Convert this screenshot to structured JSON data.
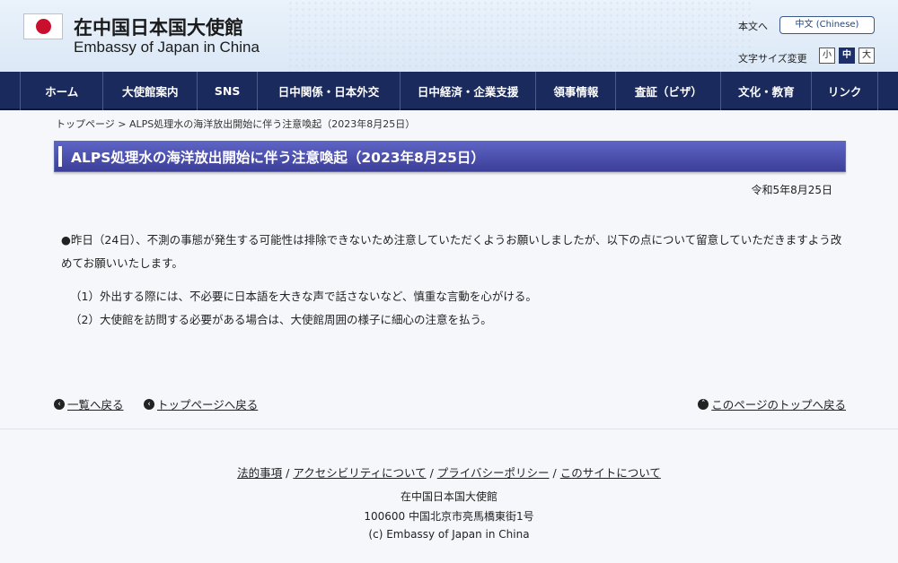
{
  "header": {
    "title_ja": "在中国日本国大使館",
    "title_en": "Embassy of Japan in China",
    "lang_ja": "本文へ",
    "lang_cn": "中文 (Chinese)",
    "size_label": "文字サイズ変更",
    "sizes": [
      "小",
      "中",
      "大"
    ],
    "size_selected": "中"
  },
  "nav": [
    "ホーム",
    "大使館案内",
    "SNS",
    "日中関係・日本外交",
    "日中経済・企業支援",
    "領事情報",
    "査証（ビザ）",
    "文化・教育",
    "リンク"
  ],
  "breadcrumb": {
    "home": "トップページ",
    "sep": " > ",
    "current": "ALPS処理水の海洋放出開始に伴う注意喚起（2023年8月25日）"
  },
  "page_title": "ALPS処理水の海洋放出開始に伴う注意喚起（2023年8月25日）",
  "date": "令和5年8月25日",
  "body": {
    "paragraph": "●昨日（24日）、不測の事態が発生する可能性は排除できないため注意していただくようお願いしましたが、以下の点について留意していただきますよう改めてお願いいたします。",
    "items": [
      "（1）外出する際には、不必要に日本語を大きな声で話さないなど、慎重な言動を心がける。",
      "（2）大使館を訪問する必要がある場合は、大使館周囲の様子に細心の注意を払う。"
    ]
  },
  "back_links": {
    "list": "一覧へ戻る",
    "top_page": "トップページへ戻る",
    "page_top": "このページのトップへ戻る"
  },
  "footer": {
    "links": [
      "法的事項",
      "アクセシビリティについて",
      "プライバシーポリシー",
      "このサイトについて"
    ],
    "separator": " / ",
    "name": "在中国日本国大使館",
    "address": "100600 中国北京市亮馬橋東街1号",
    "copyright": "(c) Embassy of Japan in China"
  },
  "colors": {
    "nav_bg": "#1a2a5c",
    "title_bar": "#4648a8",
    "flag_red": "#c8102e"
  }
}
